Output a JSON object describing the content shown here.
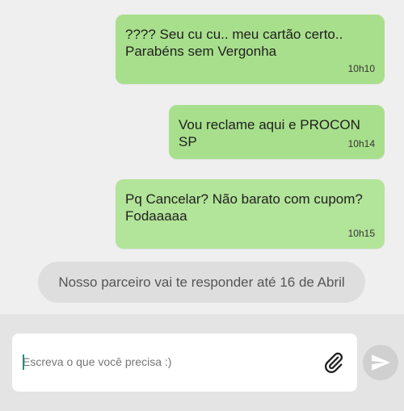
{
  "messages": [
    {
      "text_line1": "???? Seu cu cu.. meu cartão certo..",
      "text_line2": "Parabéns sem Vergonha",
      "time": "10h10"
    },
    {
      "text_line1": "Vou reclame aqui e PROCON SP",
      "time": "10h14"
    },
    {
      "text_line1": "Pq Cancelar? Não barato com cupom?",
      "text_line2": "Fodaaaaa",
      "time": "10h15"
    }
  ],
  "system_message": "Nosso parceiro vai te responder até 16 de Abril",
  "composer": {
    "placeholder": "Escreva o que você precisa :)",
    "attach_icon": "paperclip-icon",
    "send_icon": "send-icon"
  },
  "colors": {
    "bubble": "#a8df8c",
    "background": "#efefef",
    "system_pill": "#dedede",
    "send_button": "#d0d0d0"
  }
}
